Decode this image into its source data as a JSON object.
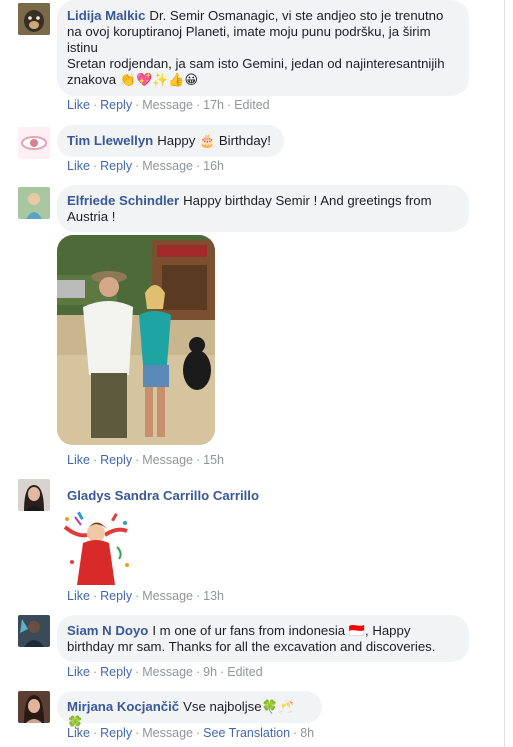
{
  "comments": [
    {
      "author": "Lidija Malkic",
      "text": "Dr. Semir Osmanagic, vi ste andjeo sto je trenutno na ovoj koruptiranoj Planeti, imate moju punu podršku, ja širim istinu",
      "text2": "Sretan rodjendan, ja sam isto Gemini, jedan od najinteresantnijih znakova",
      "emojis": "👏💖✨👍😀",
      "actions": {
        "like": "Like",
        "reply": "Reply",
        "message": "Message",
        "time": "17h",
        "extra": "Edited"
      }
    },
    {
      "author": "Tim Llewellyn",
      "text_before": "Happy",
      "emoji": "🎂",
      "text_after": "Birthday!",
      "actions": {
        "like": "Like",
        "reply": "Reply",
        "message": "Message",
        "time": "16h"
      }
    },
    {
      "author": "Elfriede Schindler",
      "text": "Happy birthday Semir ! And greetings from Austria !",
      "actions": {
        "like": "Like",
        "reply": "Reply",
        "message": "Message",
        "time": "15h"
      }
    },
    {
      "author": "Gladys Sandra Carrillo Carrillo",
      "actions": {
        "like": "Like",
        "reply": "Reply",
        "message": "Message",
        "time": "13h"
      }
    },
    {
      "author": "Siam N Doyo",
      "text": "I m one of ur fans from indonesia",
      "flag": "🇮🇩",
      "text2": ", Happy birthday mr sam. Thanks for all the excavation and discoveries.",
      "actions": {
        "like": "Like",
        "reply": "Reply",
        "message": "Message",
        "time": "9h",
        "extra": "Edited"
      }
    },
    {
      "author": "Mirjana Kocjančič",
      "text": "Vse najboljse",
      "emojis": "🍀🥂🍀",
      "actions": {
        "like": "Like",
        "reply": "Reply",
        "message": "Message",
        "translate": "See Translation",
        "time": "8h"
      }
    }
  ],
  "colors": {
    "link": "#4267b2",
    "author": "#385898",
    "bubble": "#f2f3f5",
    "muted": "#90949c"
  }
}
